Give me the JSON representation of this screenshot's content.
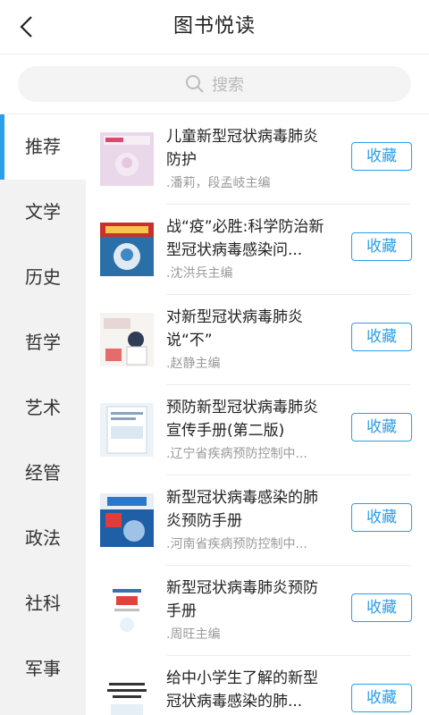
{
  "header": {
    "title": "图书悦读",
    "back_icon": "back-arrow-icon"
  },
  "search": {
    "placeholder": "搜索",
    "icon": "search-icon"
  },
  "sidebar": {
    "items": [
      {
        "label": "推荐",
        "active": true
      },
      {
        "label": "文学",
        "active": false
      },
      {
        "label": "历史",
        "active": false
      },
      {
        "label": "哲学",
        "active": false
      },
      {
        "label": "艺术",
        "active": false
      },
      {
        "label": "经管",
        "active": false
      },
      {
        "label": "政法",
        "active": false
      },
      {
        "label": "社科",
        "active": false
      },
      {
        "label": "军事",
        "active": false
      }
    ]
  },
  "books": [
    {
      "title": "儿童新型冠状病毒肺炎防护",
      "author": ".潘莉，段孟岐主编",
      "fav": "收藏"
    },
    {
      "title": "战“疫”必胜:科学防治新型冠状病毒感染问...",
      "author": ".沈洪兵主编",
      "fav": "收藏"
    },
    {
      "title": "对新型冠状病毒肺炎说“不”",
      "author": ".赵静主编",
      "fav": "收藏"
    },
    {
      "title": "预防新型冠状病毒肺炎宣传手册(第二版)",
      "author": ".辽宁省疾病预防控制中...",
      "fav": "收藏"
    },
    {
      "title": "新型冠状病毒感染的肺炎预防手册",
      "author": ".河南省疾病预防控制中...",
      "fav": "收藏"
    },
    {
      "title": "新型冠状病毒肺炎预防手册",
      "author": ".周旺主编",
      "fav": "收藏"
    },
    {
      "title": "给中小学生了解的新型冠状病毒感染的肺...",
      "author": "",
      "fav": "收藏"
    }
  ],
  "colors": {
    "accent": "#2a9ee8",
    "sidebar_bg": "#f2f2f2"
  }
}
